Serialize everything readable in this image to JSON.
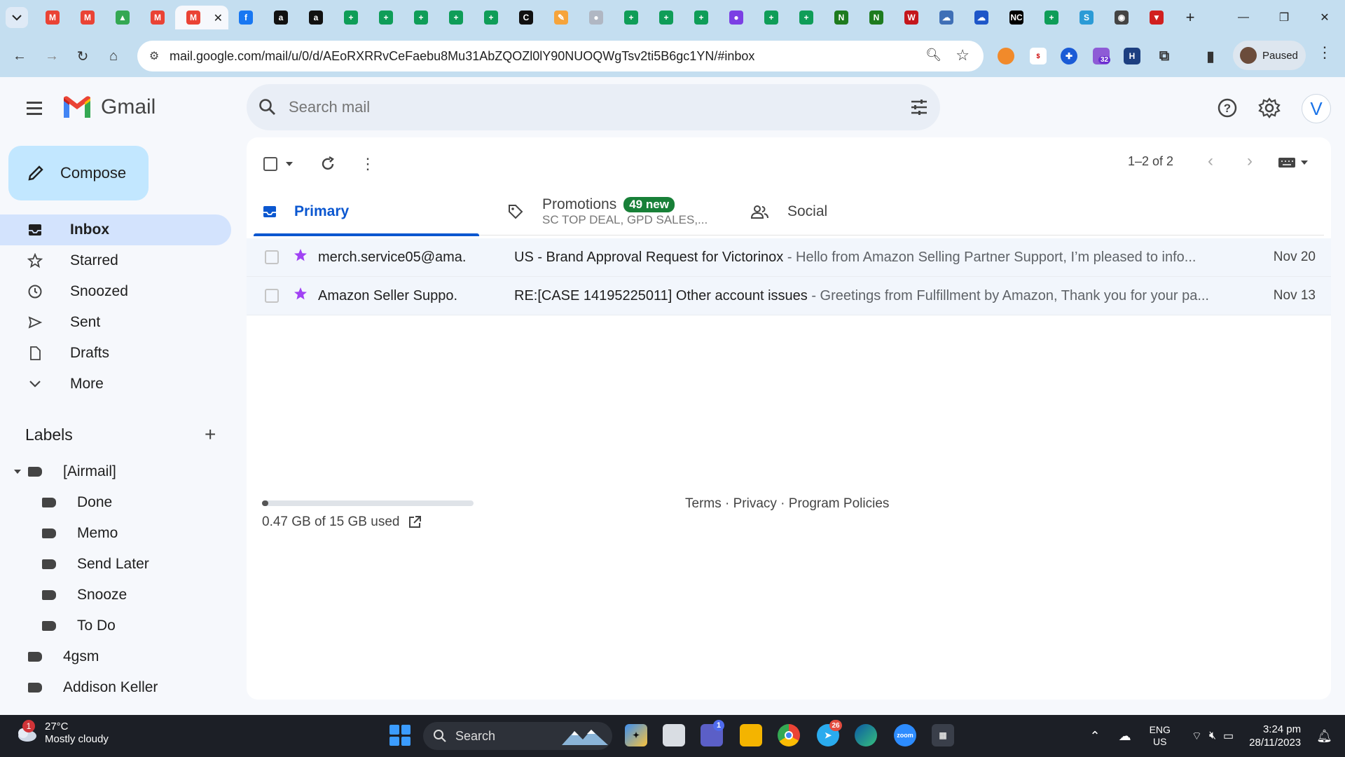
{
  "browser": {
    "url": "mail.google.com/mail/u/0/d/AEoRXRRvCeFaebu8Mu31AbZQOZl0lY90NUOQWgTsv2ti5B6gc1YN/#inbox",
    "profile_label": "Paused",
    "extension_badge": "32",
    "tabs": [
      {
        "icon": "gmail-icon",
        "color": "#ea4335",
        "glyph": "M"
      },
      {
        "icon": "gmail-icon",
        "color": "#ea4335",
        "glyph": "M"
      },
      {
        "icon": "google-drive-icon",
        "color": "#34a853",
        "glyph": "▲"
      },
      {
        "icon": "gmail-icon",
        "color": "#ea4335",
        "glyph": "M"
      },
      {
        "icon": "gmail-icon",
        "color": "#ea4335",
        "glyph": "M",
        "active": true
      },
      {
        "icon": "facebook-icon",
        "color": "#1877f2",
        "glyph": "f"
      },
      {
        "icon": "amazon-icon",
        "color": "#111111",
        "glyph": "a"
      },
      {
        "icon": "amazon-icon",
        "color": "#111111",
        "glyph": "a"
      },
      {
        "icon": "sheets-icon",
        "color": "#0f9d58",
        "glyph": "+"
      },
      {
        "icon": "sheets-icon",
        "color": "#0f9d58",
        "glyph": "+"
      },
      {
        "icon": "sheets-icon",
        "color": "#0f9d58",
        "glyph": "+"
      },
      {
        "icon": "sheets-icon",
        "color": "#0f9d58",
        "glyph": "+"
      },
      {
        "icon": "sheets-icon",
        "color": "#0f9d58",
        "glyph": "+"
      },
      {
        "icon": "circle-c-icon",
        "color": "#111111",
        "glyph": "C"
      },
      {
        "icon": "pencil-app-icon",
        "color": "#f6a43b",
        "glyph": "✎"
      },
      {
        "icon": "globe-icon",
        "color": "#b0b7c3",
        "glyph": "●"
      },
      {
        "icon": "sheets-icon",
        "color": "#0f9d58",
        "glyph": "+"
      },
      {
        "icon": "sheets-icon",
        "color": "#0f9d58",
        "glyph": "+"
      },
      {
        "icon": "sheets-icon",
        "color": "#0f9d58",
        "glyph": "+"
      },
      {
        "icon": "chat-bubble-icon",
        "color": "#7b3fe4",
        "glyph": "●"
      },
      {
        "icon": "sheets-icon",
        "color": "#0f9d58",
        "glyph": "+"
      },
      {
        "icon": "sheets-icon",
        "color": "#0f9d58",
        "glyph": "+"
      },
      {
        "icon": "n-logo-icon",
        "color": "#1e7b1e",
        "glyph": "N"
      },
      {
        "icon": "n-logo-icon",
        "color": "#1e7b1e",
        "glyph": "N"
      },
      {
        "icon": "w-logo-icon",
        "color": "#c4161c",
        "glyph": "W"
      },
      {
        "icon": "cloud-app-icon",
        "color": "#3f6fb6",
        "glyph": "☁"
      },
      {
        "icon": "cloud-app-icon",
        "color": "#1e56c8",
        "glyph": "☁"
      },
      {
        "icon": "nc-logo-icon",
        "color": "#000000",
        "glyph": "NC"
      },
      {
        "icon": "sheets-icon",
        "color": "#0f9d58",
        "glyph": "+"
      },
      {
        "icon": "sysco-icon",
        "color": "#2b9bd6",
        "glyph": "S"
      },
      {
        "icon": "circle-logo-icon",
        "color": "#444444",
        "glyph": "◉"
      },
      {
        "icon": "shield-logo-icon",
        "color": "#d11f1f",
        "glyph": "▼"
      }
    ]
  },
  "gmail": {
    "app_name": "Gmail",
    "search_placeholder": "Search mail",
    "avatar_letter": "V",
    "compose_label": "Compose",
    "nav": [
      {
        "label": "Inbox",
        "icon": "inbox-icon",
        "active": true
      },
      {
        "label": "Starred",
        "icon": "star-icon"
      },
      {
        "label": "Snoozed",
        "icon": "clock-icon"
      },
      {
        "label": "Sent",
        "icon": "send-icon"
      },
      {
        "label": "Drafts",
        "icon": "draft-icon"
      },
      {
        "label": "More",
        "icon": "chevron-down-icon"
      }
    ],
    "labels_title": "Labels",
    "labels": [
      {
        "label": "[Airmail]",
        "level": 0,
        "expanded": true
      },
      {
        "label": "Done",
        "level": 1
      },
      {
        "label": "Memo",
        "level": 1
      },
      {
        "label": "Send Later",
        "level": 1
      },
      {
        "label": "Snooze",
        "level": 1
      },
      {
        "label": "To Do",
        "level": 1
      },
      {
        "label": "4gsm",
        "level": 0
      },
      {
        "label": "Addison Keller",
        "level": 0
      }
    ],
    "pager_text": "1–2 of 2",
    "tabs": {
      "primary": "Primary",
      "promotions": "Promotions",
      "promotions_badge": "49 new",
      "promotions_sub": "SC TOP DEAL, GPD SALES,...",
      "social": "Social"
    },
    "emails": [
      {
        "sender": "merch.service05@ama.",
        "subject": "US - Brand Approval Request for Victorinox",
        "snippet": " - Hello from Amazon Selling Partner Support, I’m pleased to info...",
        "date": "Nov 20"
      },
      {
        "sender": "Amazon Seller Suppo.",
        "subject": "RE:[CASE 14195225011] Other account issues",
        "snippet": " - Greetings from Fulfillment by Amazon, Thank you for your pa...",
        "date": "Nov 13"
      }
    ],
    "storage_text": "0.47 GB of 15 GB used",
    "storage_fraction": 0.031,
    "footer": "Terms · Privacy · Program Policies"
  },
  "taskbar": {
    "weather_temp": "27°C",
    "weather_desc": "Mostly cloudy",
    "weather_alert": "1",
    "search_label": "Search",
    "teams_badge": "1",
    "telegram_badge": "26",
    "lang_line1": "ENG",
    "lang_line2": "US",
    "time": "3:24 pm",
    "date": "28/11/2023"
  }
}
